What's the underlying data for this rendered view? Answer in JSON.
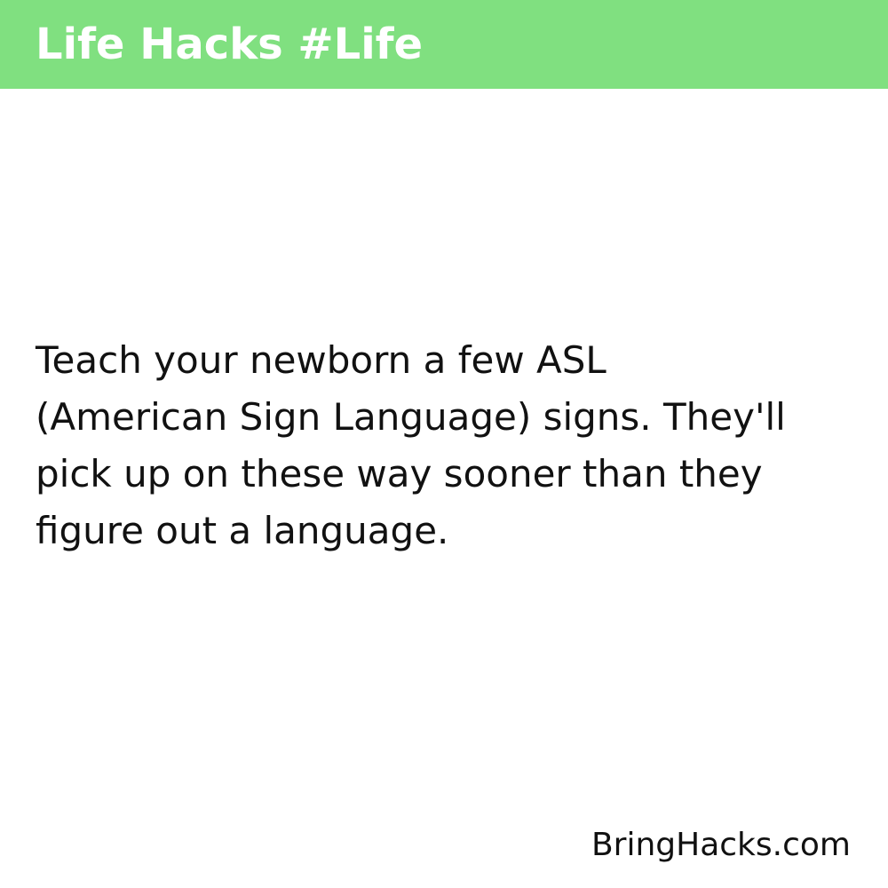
{
  "header": {
    "title": "Life Hacks #Life",
    "background_color": "#80e080",
    "text_color": "#ffffff"
  },
  "hack": {
    "lines": [
      "Teach your newborn a few ASL",
      "(American Sign Language) signs. They'll",
      "pick up on these way sooner than they",
      "figure out a language."
    ],
    "text_color": "#111111"
  },
  "footer": {
    "brand": "BringHacks.com"
  }
}
